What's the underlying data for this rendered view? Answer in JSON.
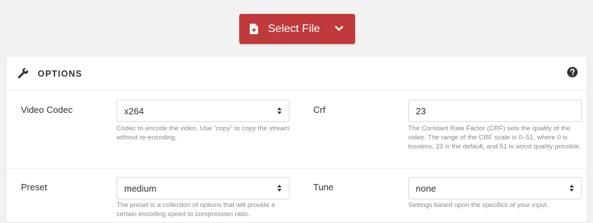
{
  "select_file": {
    "label": "Select File",
    "icon": "file-plus-icon",
    "dropdown_icon": "chevron-down-icon",
    "color": "#c0393b"
  },
  "panel": {
    "title": "OPTIONS",
    "title_icon": "wrench-icon",
    "help_icon": "question-circle-icon"
  },
  "fields": {
    "video_codec": {
      "label": "Video Codec",
      "value": "x264",
      "hint": "Codec to encode the video. Use \"copy\" to copy the stream without re-encoding."
    },
    "crf": {
      "label": "Crf",
      "value": "23",
      "hint": "The Constant Rate Factor (CRF) sets the quality of the video. The range of the CRF scale is 0–51, where 0 is lossless, 23 is the default, and 51 is worst quality possible."
    },
    "preset": {
      "label": "Preset",
      "value": "medium",
      "hint": "The preset is a collection of options that will provide a certain encoding speed to compression ratio."
    },
    "tune": {
      "label": "Tune",
      "value": "none",
      "hint": "Settings based upon the specifics of your input."
    }
  }
}
